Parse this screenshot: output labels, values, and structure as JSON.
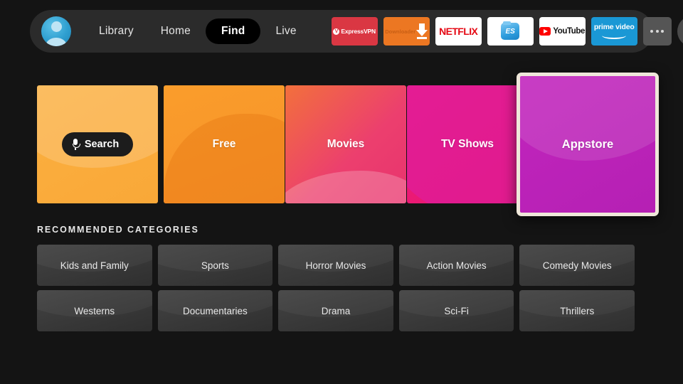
{
  "nav": {
    "avatar_name": "profile-avatar",
    "links": [
      {
        "label": "Library",
        "active": false
      },
      {
        "label": "Home",
        "active": false
      },
      {
        "label": "Find",
        "active": true
      },
      {
        "label": "Live",
        "active": false
      }
    ],
    "apps": [
      {
        "name": "expressvpn",
        "label": "ExpressVPN"
      },
      {
        "name": "downloader",
        "label": "Downloader"
      },
      {
        "name": "netflix",
        "label": "NETFLIX"
      },
      {
        "name": "es-file-explorer",
        "label": "ES"
      },
      {
        "name": "youtube",
        "label": "YouTube"
      },
      {
        "name": "prime-video",
        "label": "prime video"
      },
      {
        "name": "more",
        "label": ""
      }
    ],
    "settings_label": "",
    "more_label": ""
  },
  "hero": {
    "tiles": [
      {
        "label": "Search",
        "key": "search",
        "selected": false,
        "color": "#fbb040"
      },
      {
        "label": "Free",
        "key": "free",
        "selected": false,
        "color": "#fa9d2b"
      },
      {
        "label": "Movies",
        "key": "movies",
        "selected": false,
        "color": "#ec3f6e"
      },
      {
        "label": "TV Shows",
        "key": "tv-shows",
        "selected": false,
        "color": "#ee1b7a"
      },
      {
        "label": "Appstore",
        "key": "appstore",
        "selected": true,
        "color": "#c225bd"
      }
    ],
    "search_pill_label": "Search"
  },
  "categories": {
    "section_title": "RECOMMENDED CATEGORIES",
    "items": [
      "Kids and Family",
      "Sports",
      "Horror Movies",
      "Action Movies",
      "Comedy Movies",
      "Westerns",
      "Documentaries",
      "Drama",
      "Sci-Fi",
      "Thrillers"
    ]
  },
  "theme": {
    "page_background": "#141414",
    "navbar_background": "#2b2b2b",
    "active_pill_background": "#000000",
    "selection_border": "#efe7da"
  }
}
